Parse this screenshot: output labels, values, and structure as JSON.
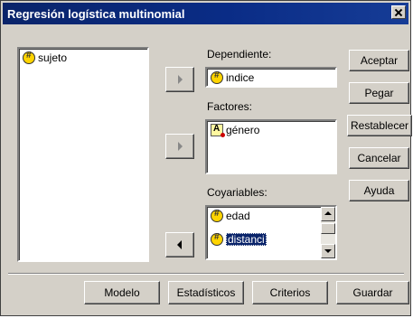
{
  "window": {
    "title": "Regresión logística multinomial"
  },
  "source_list": {
    "items": [
      {
        "label": "sujeto",
        "icon": "scale-variable-icon"
      }
    ]
  },
  "dependent": {
    "label": "Dependiente:",
    "value": "indice",
    "icon": "scale-variable-icon"
  },
  "factors": {
    "label": "Factores:",
    "items": [
      {
        "label": "género",
        "icon": "nominal-variable-icon"
      }
    ]
  },
  "covariates": {
    "label": "Coyariables:",
    "items": [
      {
        "label": "edad",
        "icon": "scale-variable-icon",
        "selected": false
      },
      {
        "label": "distanci",
        "icon": "scale-variable-icon",
        "selected": true
      }
    ]
  },
  "side_buttons": {
    "accept": "Aceptar",
    "paste": "Pegar",
    "reset": "Restablecer",
    "cancel": "Cancelar",
    "help": "Ayuda"
  },
  "bottom_buttons": {
    "model": "Modelo",
    "statistics": "Estadísticos",
    "criteria": "Criterios",
    "save": "Guardar"
  },
  "colors": {
    "titlebar": "#0a246a",
    "face": "#d4d0c8",
    "selection": "#0a246a"
  }
}
